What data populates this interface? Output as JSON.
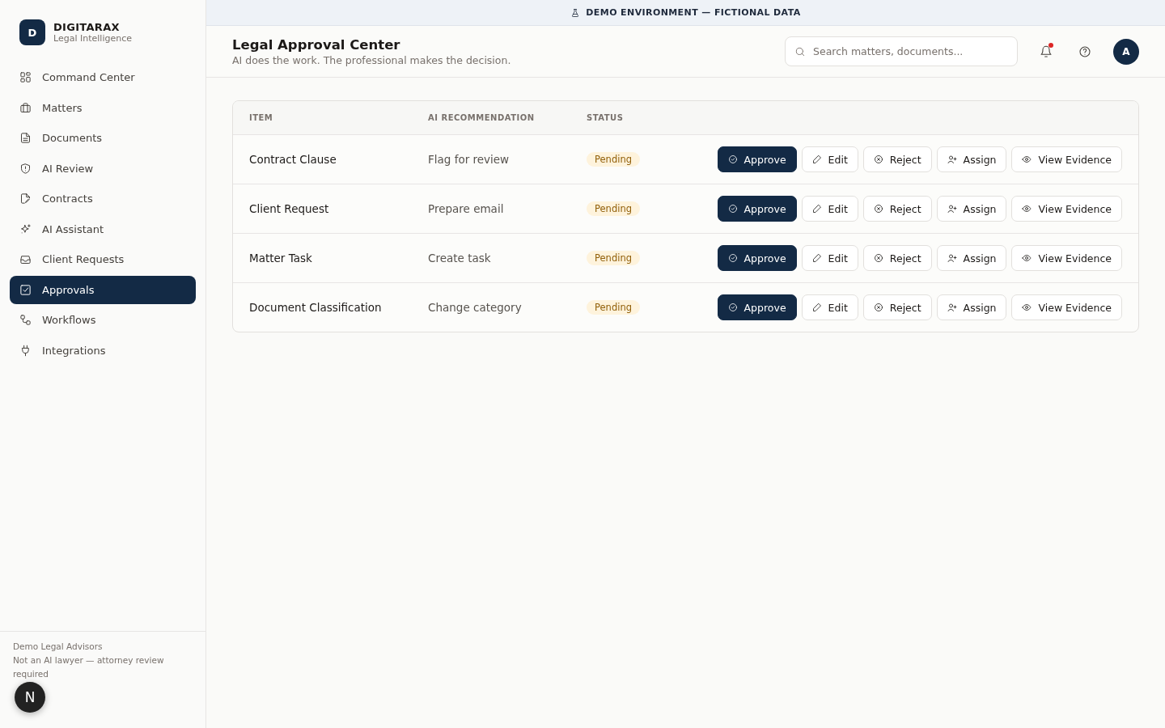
{
  "banner": {
    "text": "DEMO ENVIRONMENT — FICTIONAL DATA"
  },
  "brand": {
    "logo": "D",
    "name": "DIGITARAX",
    "tagline": "Legal Intelligence"
  },
  "sidebar": {
    "items": [
      {
        "label": "Command Center",
        "selected": false
      },
      {
        "label": "Matters",
        "selected": false
      },
      {
        "label": "Documents",
        "selected": false
      },
      {
        "label": "AI Review",
        "selected": false
      },
      {
        "label": "Contracts",
        "selected": false
      },
      {
        "label": "AI Assistant",
        "selected": false
      },
      {
        "label": "Client Requests",
        "selected": false
      },
      {
        "label": "Approvals",
        "selected": true
      },
      {
        "label": "Workflows",
        "selected": false
      },
      {
        "label": "Integrations",
        "selected": false
      }
    ],
    "footer": {
      "org": "Demo Legal Advisors",
      "note": "Not an AI lawyer — attorney review required"
    }
  },
  "header": {
    "title": "Legal Approval Center",
    "subtitle": "AI does the work. The professional makes the decision.",
    "search": {
      "placeholder": "Search matters, documents..."
    },
    "notifications_unread": true,
    "avatar": "A"
  },
  "table": {
    "columns": [
      "ITEM",
      "AI RECOMMENDATION",
      "STATUS"
    ],
    "rows": [
      {
        "item": "Contract Clause",
        "recommendation": "Flag for review",
        "status": "Pending",
        "actions": [
          {
            "label": "Approve",
            "kind": "approve"
          },
          {
            "label": "Edit",
            "kind": "edit"
          },
          {
            "label": "Reject",
            "kind": "reject"
          },
          {
            "label": "Assign",
            "kind": "assign"
          },
          {
            "label": "View Evidence",
            "kind": "evidence"
          }
        ]
      },
      {
        "item": "Client Request",
        "recommendation": "Prepare email",
        "status": "Pending",
        "actions": [
          {
            "label": "Approve",
            "kind": "approve"
          },
          {
            "label": "Edit",
            "kind": "edit"
          },
          {
            "label": "Reject",
            "kind": "reject"
          },
          {
            "label": "Assign",
            "kind": "assign"
          },
          {
            "label": "View Evidence",
            "kind": "evidence"
          }
        ]
      },
      {
        "item": "Matter Task",
        "recommendation": "Create task",
        "status": "Pending",
        "actions": [
          {
            "label": "Approve",
            "kind": "approve"
          },
          {
            "label": "Edit",
            "kind": "edit"
          },
          {
            "label": "Reject",
            "kind": "reject"
          },
          {
            "label": "Assign",
            "kind": "assign"
          },
          {
            "label": "View Evidence",
            "kind": "evidence"
          }
        ]
      },
      {
        "item": "Document Classification",
        "recommendation": "Change category",
        "status": "Pending",
        "actions": [
          {
            "label": "Approve",
            "kind": "approve"
          },
          {
            "label": "Edit",
            "kind": "edit"
          },
          {
            "label": "Reject",
            "kind": "reject"
          },
          {
            "label": "Assign",
            "kind": "assign"
          },
          {
            "label": "View Evidence",
            "kind": "evidence"
          }
        ]
      }
    ]
  },
  "dev_badge": {
    "label": "N"
  }
}
